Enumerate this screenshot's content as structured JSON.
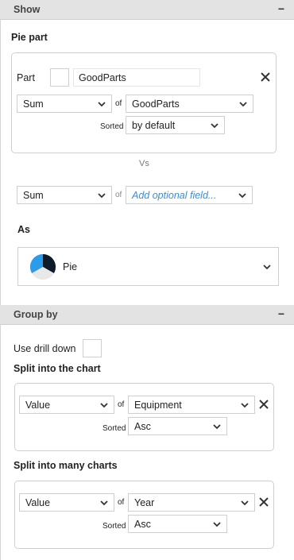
{
  "show_section": {
    "title": "Show",
    "toggle": "−",
    "pie_part_label": "Pie part",
    "part_label": "Part",
    "part_name_value": "GoodParts",
    "aggregate": "Sum",
    "of_label": "of",
    "field": "GoodParts",
    "sorted_label": "Sorted",
    "sort_value": "by default",
    "vs_label": "Vs",
    "vs_aggregate": "Sum",
    "vs_of_label": "of",
    "vs_field_placeholder": "Add optional field...",
    "as_label": "As",
    "chart_type": "Pie",
    "chart_type_icon": "pie-chart-icon"
  },
  "group_section": {
    "title": "Group by",
    "toggle": "−",
    "drill_down_label": "Use drill down",
    "split_chart_label": "Split into the chart",
    "split_chart": {
      "aggregate": "Value",
      "of_label": "of",
      "field": "Equipment",
      "sorted_label": "Sorted",
      "sort_value": "Asc"
    },
    "split_many_label": "Split into many charts",
    "split_many": {
      "aggregate": "Value",
      "of_label": "of",
      "field": "Year",
      "sorted_label": "Sorted",
      "sort_value": "Asc"
    }
  },
  "colors": {
    "accent": "#3a8fd6",
    "header_bg": "#e3e3e3",
    "border": "#cfcfcf",
    "pie_dark": "#0d1b2a",
    "pie_blue": "#2e9be8",
    "pie_light": "#e8e8e8"
  }
}
